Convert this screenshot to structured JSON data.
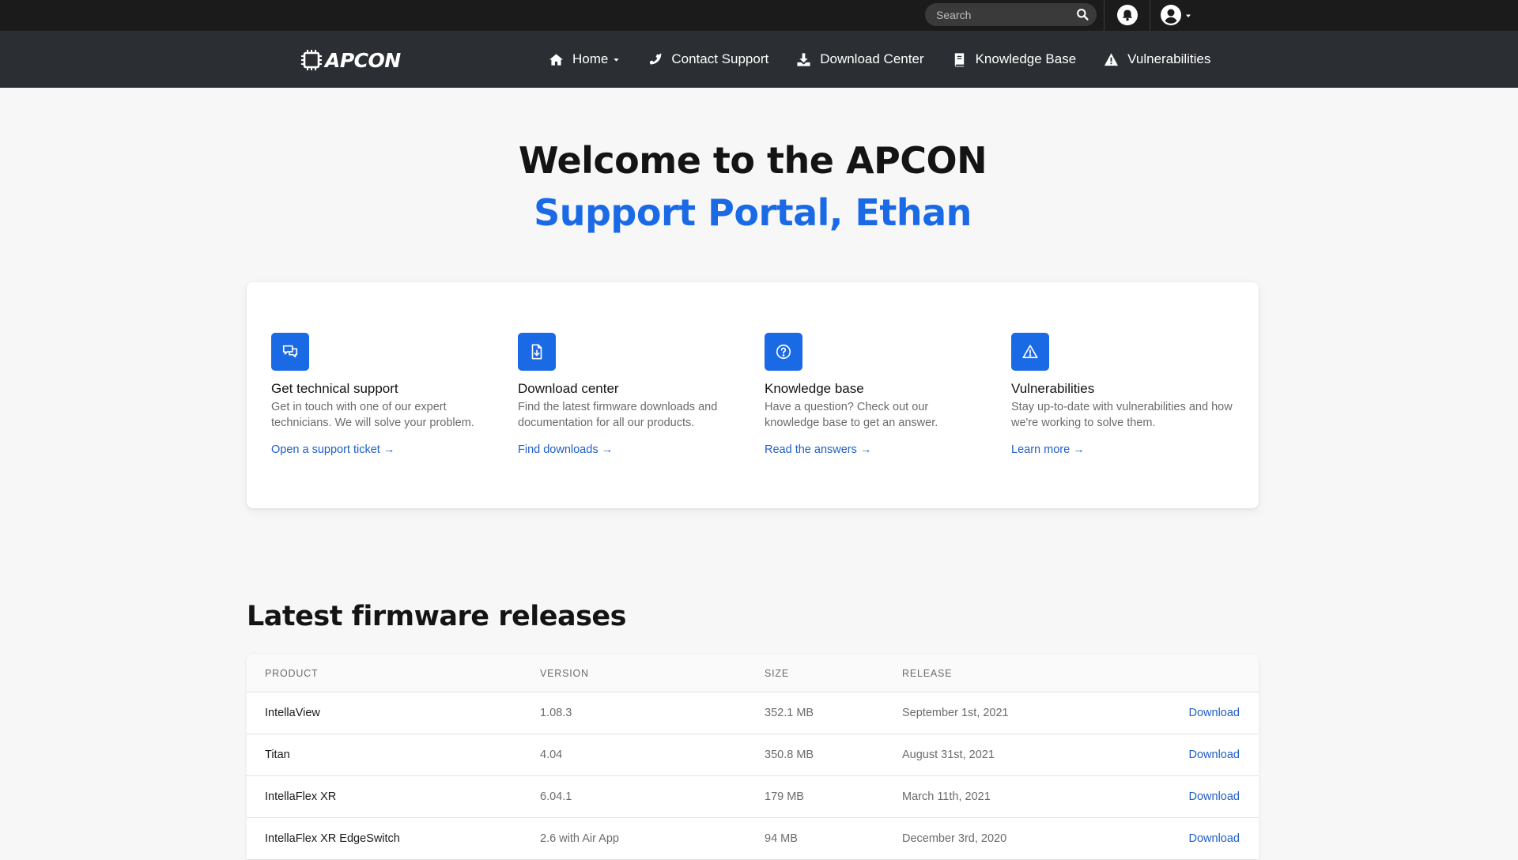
{
  "topbar": {
    "search_placeholder": "Search",
    "icons": {
      "search": "search-icon",
      "notifications": "bell-icon",
      "account": "user-circle-icon",
      "account_menu": "caret-down-icon"
    }
  },
  "brand": {
    "logo_text": "APCON"
  },
  "nav": {
    "items": [
      {
        "label": "Home",
        "icon": "home-icon",
        "has_dropdown": true
      },
      {
        "label": "Contact Support",
        "icon": "phone-icon"
      },
      {
        "label": "Download Center",
        "icon": "download-icon"
      },
      {
        "label": "Knowledge Base",
        "icon": "book-icon"
      },
      {
        "label": "Vulnerabilities",
        "icon": "warning-icon"
      }
    ]
  },
  "hero": {
    "line1": "Welcome to the APCON",
    "line2": "Support Portal, Ethan"
  },
  "features": [
    {
      "icon": "chat-icon",
      "title": "Get technical support",
      "description": "Get in touch with one of our expert technicians. We will solve your problem.",
      "link": "Open a support ticket →"
    },
    {
      "icon": "file-download-icon",
      "title": "Download center",
      "description": "Find the latest firmware downloads and documentation for all our products.",
      "link": "Find downloads →"
    },
    {
      "icon": "question-icon",
      "title": "Knowledge base",
      "description": "Have a question? Check out our knowledge base to get an answer.",
      "link": "Read the answers →"
    },
    {
      "icon": "alert-triangle-icon",
      "title": "Vulnerabilities",
      "description": "Stay up-to-date with vulnerabilities and how we're working to solve them.",
      "link": "Learn more →"
    }
  ],
  "firmware": {
    "title": "Latest firmware releases",
    "columns": [
      "PRODUCT",
      "VERSION",
      "SIZE",
      "RELEASE"
    ],
    "rows": [
      {
        "product": "IntellaView",
        "version": "1.08.3",
        "size": "352.1 MB",
        "release": "September 1st, 2021",
        "action": "Download"
      },
      {
        "product": "Titan",
        "version": "4.04",
        "size": "350.8 MB",
        "release": "August 31st, 2021",
        "action": "Download"
      },
      {
        "product": "IntellaFlex XR",
        "version": "6.04.1",
        "size": "179 MB",
        "release": "March 11th, 2021",
        "action": "Download"
      },
      {
        "product": "IntellaFlex XR EdgeSwitch",
        "version": "2.6 with Air App",
        "size": "94 MB",
        "release": "December 3rd, 2020",
        "action": "Download"
      }
    ]
  },
  "colors": {
    "accent": "#1a6ae6",
    "link": "#1f5fc7",
    "topbar": "#1b1b1b",
    "navbar": "#2b2e33"
  }
}
